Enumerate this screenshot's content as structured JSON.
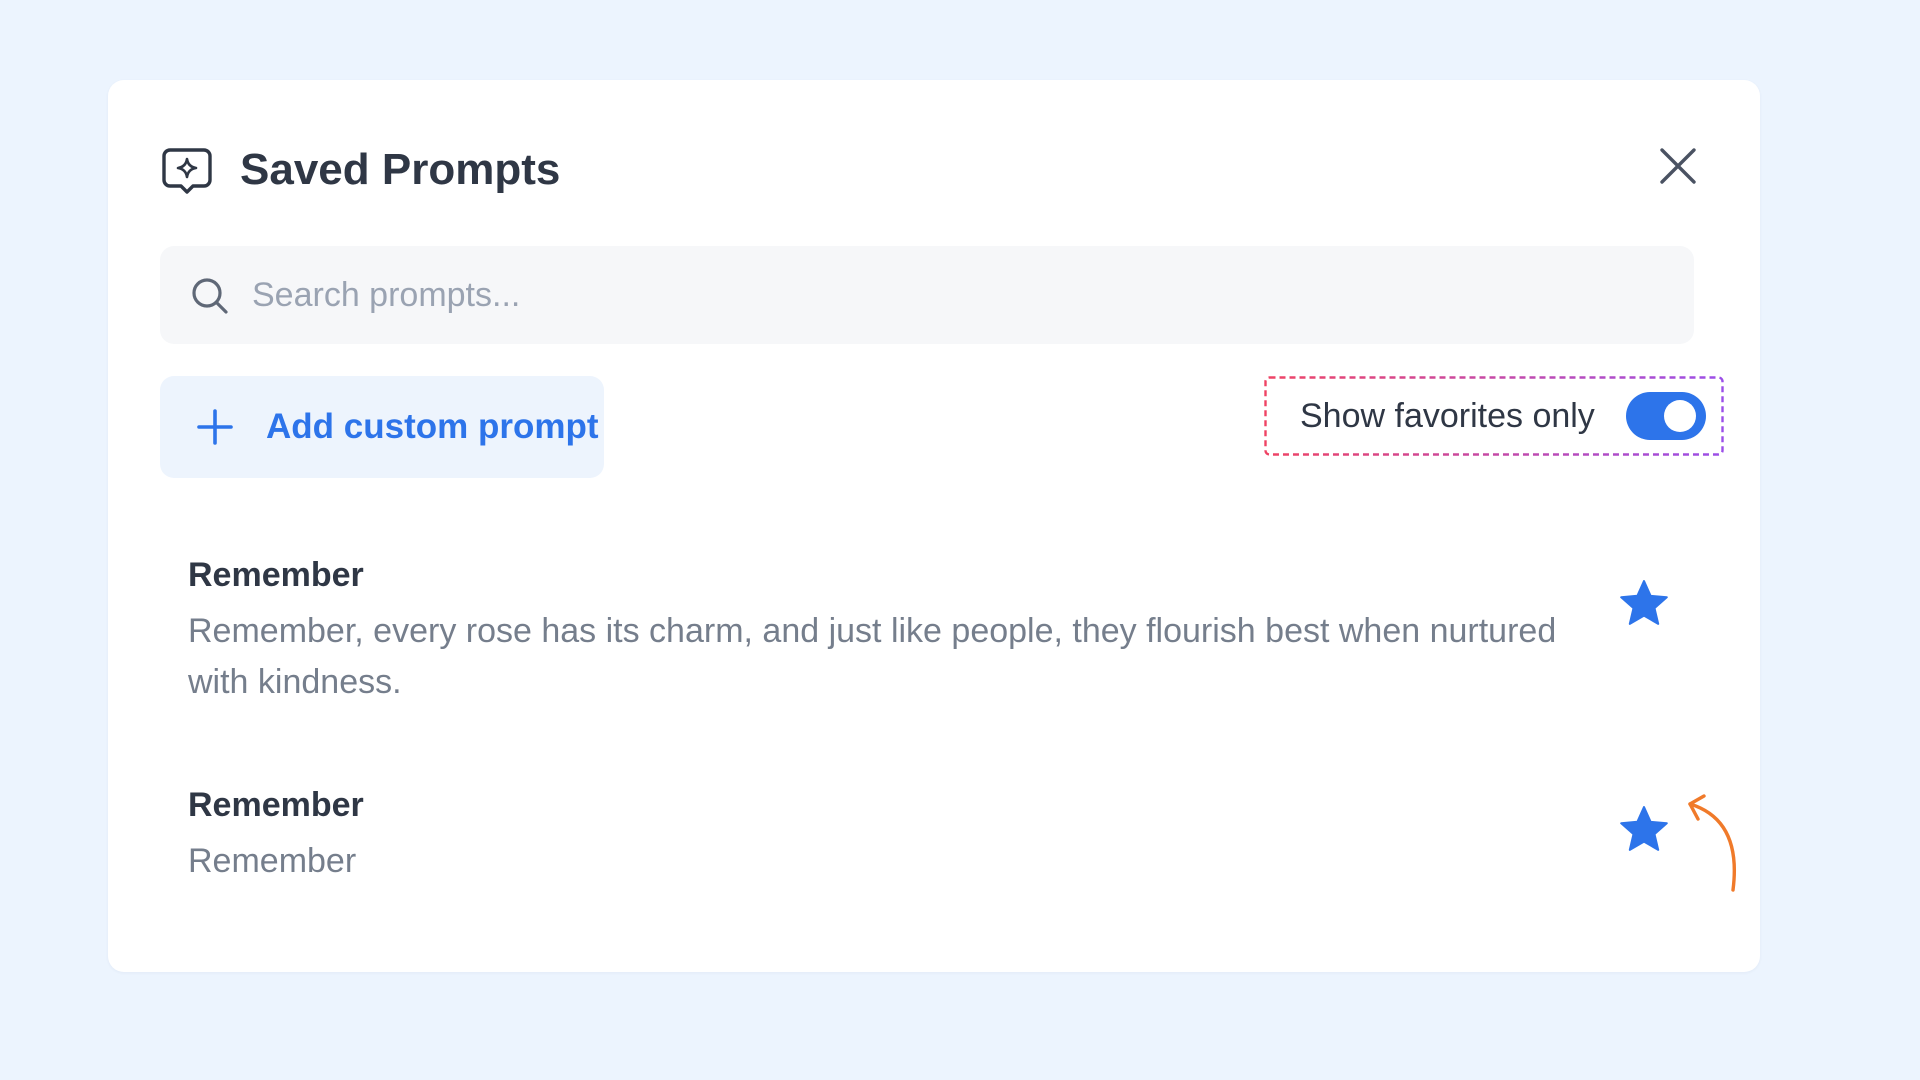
{
  "dialog": {
    "title": "Saved Prompts",
    "header_icon": "chat-sparkle-icon",
    "close_icon": "close-icon"
  },
  "search": {
    "placeholder": "Search prompts...",
    "value": "",
    "icon": "search-icon"
  },
  "add_button": {
    "label": "Add custom prompt",
    "icon": "plus-icon"
  },
  "favorites_toggle": {
    "label": "Show favorites only",
    "checked": true
  },
  "prompts": [
    {
      "title": "Remember",
      "text": "Remember, every rose has its charm, and just like people, they flourish best when nurtured with kindness.",
      "favorite": true,
      "icon": "star-icon"
    },
    {
      "title": "Remember",
      "text": "Remember",
      "favorite": true,
      "icon": "star-icon"
    }
  ],
  "annotation": {
    "arrow_icon": "curved-arrow-icon",
    "highlight": "dashed-highlight-box"
  },
  "colors": {
    "page_background": "#ecf4fe",
    "panel_background": "#ffffff",
    "accent": "#2d74ea",
    "title_text": "#2f3745",
    "muted_text": "#757e8c",
    "annotation_arrow": "#f07a2a",
    "highlight_dash_start": "#ef4364",
    "highlight_dash_end": "#9b4ee8"
  }
}
